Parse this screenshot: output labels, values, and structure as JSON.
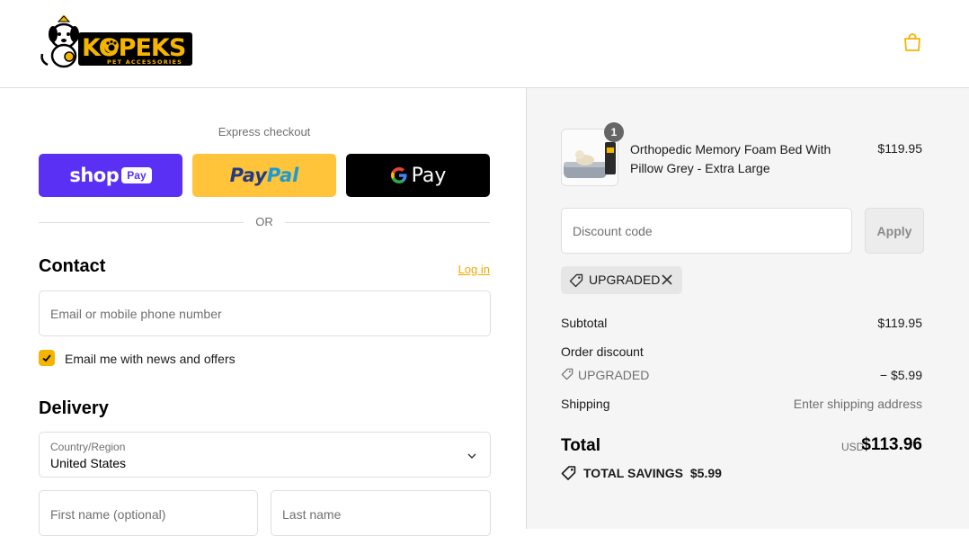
{
  "brand": {
    "name": "KOPEKS",
    "tagline": "PET ACCESSORIES",
    "accent": "#f5b400"
  },
  "header": {
    "cart_icon": "shopping-bag-icon"
  },
  "express": {
    "title": "Express checkout",
    "shop_pay": {
      "label_shop": "shop",
      "label_pay": "Pay"
    },
    "paypal": {
      "label_pay": "Pay",
      "label_pal": "Pal"
    },
    "gpay": {
      "label": "Pay"
    },
    "or": "OR"
  },
  "contact": {
    "title": "Contact",
    "login": "Log in",
    "email_placeholder": "Email or mobile phone number",
    "newsletter_label": "Email me with news and offers",
    "newsletter_checked": true
  },
  "delivery": {
    "title": "Delivery",
    "country_label": "Country/Region",
    "country_value": "United States",
    "first_name_placeholder": "First name (optional)",
    "last_name_placeholder": "Last name"
  },
  "order": {
    "item": {
      "name": "Orthopedic Memory Foam Bed With Pillow Grey - Extra Large",
      "price": "$119.95",
      "quantity": "1"
    },
    "discount_placeholder": "Discount code",
    "apply": "Apply",
    "applied_code": "UPGRADED",
    "subtotal_label": "Subtotal",
    "subtotal_value": "$119.95",
    "order_discount_label": "Order discount",
    "discount_code": "UPGRADED",
    "discount_value": "− $5.99",
    "shipping_label": "Shipping",
    "shipping_value": "Enter shipping address",
    "total_label": "Total",
    "currency": "USD",
    "total_value": "$113.96",
    "savings_label": "TOTAL SAVINGS",
    "savings_value": "$5.99"
  }
}
